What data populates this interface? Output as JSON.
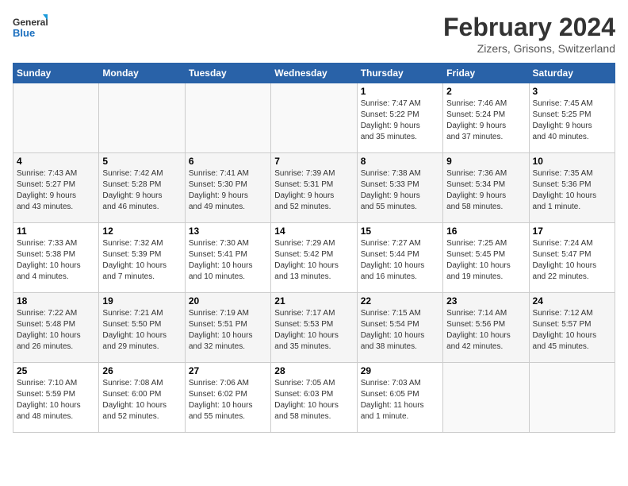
{
  "header": {
    "logo_line1": "General",
    "logo_line2": "Blue",
    "month": "February 2024",
    "location": "Zizers, Grisons, Switzerland"
  },
  "weekdays": [
    "Sunday",
    "Monday",
    "Tuesday",
    "Wednesday",
    "Thursday",
    "Friday",
    "Saturday"
  ],
  "weeks": [
    [
      {
        "day": "",
        "info": ""
      },
      {
        "day": "",
        "info": ""
      },
      {
        "day": "",
        "info": ""
      },
      {
        "day": "",
        "info": ""
      },
      {
        "day": "1",
        "info": "Sunrise: 7:47 AM\nSunset: 5:22 PM\nDaylight: 9 hours\nand 35 minutes."
      },
      {
        "day": "2",
        "info": "Sunrise: 7:46 AM\nSunset: 5:24 PM\nDaylight: 9 hours\nand 37 minutes."
      },
      {
        "day": "3",
        "info": "Sunrise: 7:45 AM\nSunset: 5:25 PM\nDaylight: 9 hours\nand 40 minutes."
      }
    ],
    [
      {
        "day": "4",
        "info": "Sunrise: 7:43 AM\nSunset: 5:27 PM\nDaylight: 9 hours\nand 43 minutes."
      },
      {
        "day": "5",
        "info": "Sunrise: 7:42 AM\nSunset: 5:28 PM\nDaylight: 9 hours\nand 46 minutes."
      },
      {
        "day": "6",
        "info": "Sunrise: 7:41 AM\nSunset: 5:30 PM\nDaylight: 9 hours\nand 49 minutes."
      },
      {
        "day": "7",
        "info": "Sunrise: 7:39 AM\nSunset: 5:31 PM\nDaylight: 9 hours\nand 52 minutes."
      },
      {
        "day": "8",
        "info": "Sunrise: 7:38 AM\nSunset: 5:33 PM\nDaylight: 9 hours\nand 55 minutes."
      },
      {
        "day": "9",
        "info": "Sunrise: 7:36 AM\nSunset: 5:34 PM\nDaylight: 9 hours\nand 58 minutes."
      },
      {
        "day": "10",
        "info": "Sunrise: 7:35 AM\nSunset: 5:36 PM\nDaylight: 10 hours\nand 1 minute."
      }
    ],
    [
      {
        "day": "11",
        "info": "Sunrise: 7:33 AM\nSunset: 5:38 PM\nDaylight: 10 hours\nand 4 minutes."
      },
      {
        "day": "12",
        "info": "Sunrise: 7:32 AM\nSunset: 5:39 PM\nDaylight: 10 hours\nand 7 minutes."
      },
      {
        "day": "13",
        "info": "Sunrise: 7:30 AM\nSunset: 5:41 PM\nDaylight: 10 hours\nand 10 minutes."
      },
      {
        "day": "14",
        "info": "Sunrise: 7:29 AM\nSunset: 5:42 PM\nDaylight: 10 hours\nand 13 minutes."
      },
      {
        "day": "15",
        "info": "Sunrise: 7:27 AM\nSunset: 5:44 PM\nDaylight: 10 hours\nand 16 minutes."
      },
      {
        "day": "16",
        "info": "Sunrise: 7:25 AM\nSunset: 5:45 PM\nDaylight: 10 hours\nand 19 minutes."
      },
      {
        "day": "17",
        "info": "Sunrise: 7:24 AM\nSunset: 5:47 PM\nDaylight: 10 hours\nand 22 minutes."
      }
    ],
    [
      {
        "day": "18",
        "info": "Sunrise: 7:22 AM\nSunset: 5:48 PM\nDaylight: 10 hours\nand 26 minutes."
      },
      {
        "day": "19",
        "info": "Sunrise: 7:21 AM\nSunset: 5:50 PM\nDaylight: 10 hours\nand 29 minutes."
      },
      {
        "day": "20",
        "info": "Sunrise: 7:19 AM\nSunset: 5:51 PM\nDaylight: 10 hours\nand 32 minutes."
      },
      {
        "day": "21",
        "info": "Sunrise: 7:17 AM\nSunset: 5:53 PM\nDaylight: 10 hours\nand 35 minutes."
      },
      {
        "day": "22",
        "info": "Sunrise: 7:15 AM\nSunset: 5:54 PM\nDaylight: 10 hours\nand 38 minutes."
      },
      {
        "day": "23",
        "info": "Sunrise: 7:14 AM\nSunset: 5:56 PM\nDaylight: 10 hours\nand 42 minutes."
      },
      {
        "day": "24",
        "info": "Sunrise: 7:12 AM\nSunset: 5:57 PM\nDaylight: 10 hours\nand 45 minutes."
      }
    ],
    [
      {
        "day": "25",
        "info": "Sunrise: 7:10 AM\nSunset: 5:59 PM\nDaylight: 10 hours\nand 48 minutes."
      },
      {
        "day": "26",
        "info": "Sunrise: 7:08 AM\nSunset: 6:00 PM\nDaylight: 10 hours\nand 52 minutes."
      },
      {
        "day": "27",
        "info": "Sunrise: 7:06 AM\nSunset: 6:02 PM\nDaylight: 10 hours\nand 55 minutes."
      },
      {
        "day": "28",
        "info": "Sunrise: 7:05 AM\nSunset: 6:03 PM\nDaylight: 10 hours\nand 58 minutes."
      },
      {
        "day": "29",
        "info": "Sunrise: 7:03 AM\nSunset: 6:05 PM\nDaylight: 11 hours\nand 1 minute."
      },
      {
        "day": "",
        "info": ""
      },
      {
        "day": "",
        "info": ""
      }
    ]
  ]
}
